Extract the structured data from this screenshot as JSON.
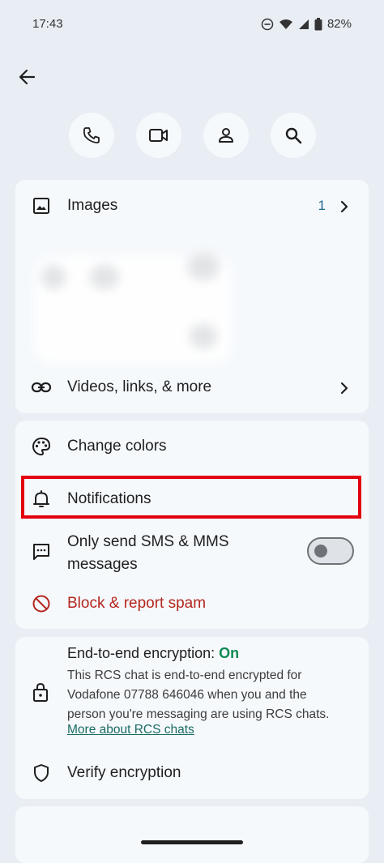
{
  "status_bar": {
    "time": "17:43",
    "battery": "82%",
    "icons": [
      "do-not-disturb-icon",
      "wifi-icon",
      "signal-icon",
      "battery-icon"
    ]
  },
  "header": {
    "back_icon": "arrow-back-icon",
    "actions": [
      {
        "name": "call",
        "icon": "phone-icon"
      },
      {
        "name": "video",
        "icon": "video-icon"
      },
      {
        "name": "contact",
        "icon": "person-icon"
      },
      {
        "name": "search",
        "icon": "search-icon"
      }
    ]
  },
  "media_card": {
    "images_label": "Images",
    "images_count": "1",
    "videos_label": "Videos, links, & more"
  },
  "settings_card": {
    "change_colors": "Change colors",
    "notifications": "Notifications",
    "sms_only_line1": "Only send SMS & MMS",
    "sms_only_line2": "messages",
    "sms_only_enabled": false,
    "block_spam": "Block & report spam"
  },
  "encryption_card": {
    "title": "End-to-end encryption: ",
    "status": "On",
    "body_line1": "This RCS chat is end-to-end encrypted for",
    "body_line2": "Vodafone 07788 646046 when you and the",
    "body_line3": "person you're messaging are using RCS chats.",
    "link": "More about RCS chats",
    "verify": "Verify encryption"
  },
  "colors": {
    "background": "#e9eef4",
    "card": "#f6f9fc",
    "accent_green": "#0b8a53",
    "danger_red": "#b3261e",
    "count_blue": "#1f6a8a",
    "highlight": "#e2000e"
  }
}
